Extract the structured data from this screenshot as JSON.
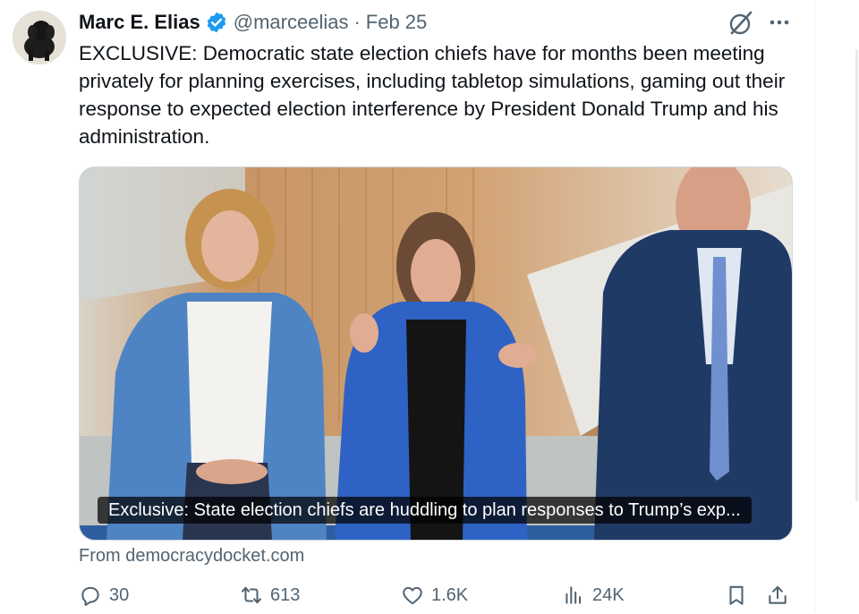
{
  "tweet": {
    "author_name": "Marc E. Elias",
    "handle": "@marceelias",
    "separator": "·",
    "date": "Feb 25",
    "text": "EXCLUSIVE: Democratic state election chiefs have for months been meeting privately for planning exercises, including tabletop simulations, gaming out their response to expected election interference by President Donald Trump and his administration."
  },
  "card": {
    "caption": "Exclusive: State election chiefs are huddling to plan responses to Trump’s exp...",
    "source": "From democracydocket.com"
  },
  "actions": {
    "replies": "30",
    "reposts": "613",
    "likes": "1.6K",
    "views": "24K"
  },
  "icons": {
    "verified": "verified-badge-icon",
    "grok": "grok-icon",
    "more": "more-icon",
    "reply": "reply-icon",
    "repost": "repost-icon",
    "like": "like-icon",
    "views": "views-icon",
    "bookmark": "bookmark-icon",
    "share": "share-icon"
  },
  "colors": {
    "text": "#0f1419",
    "secondary": "#536471",
    "verified": "#1d9bf0"
  }
}
